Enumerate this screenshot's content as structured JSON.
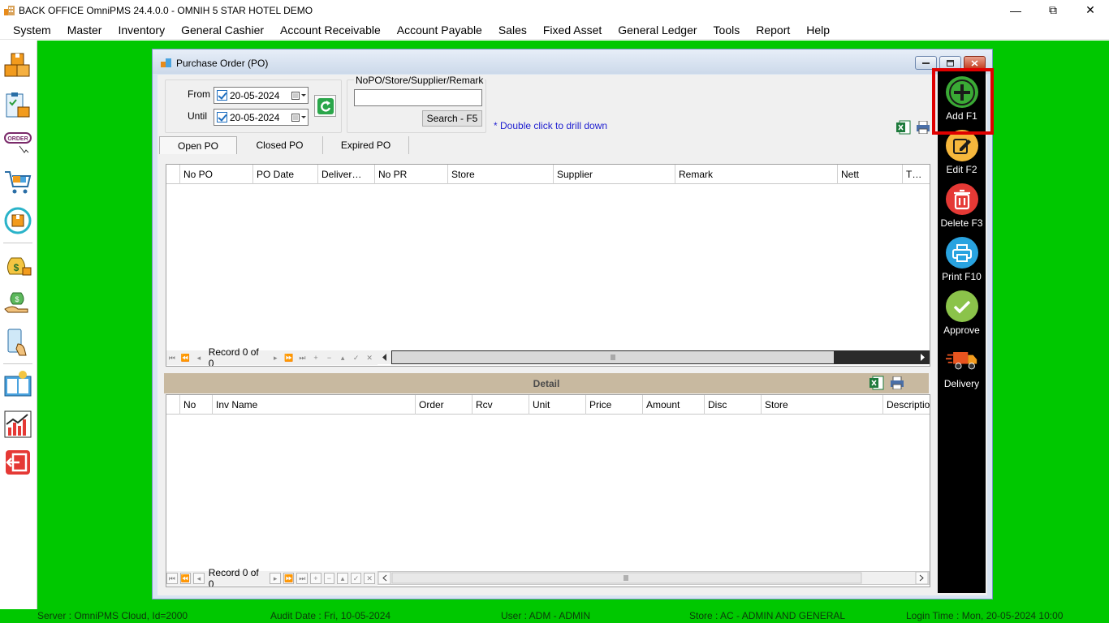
{
  "window": {
    "title": "BACK OFFICE OmniPMS 24.4.0.0 - OMNIH 5 STAR HOTEL DEMO",
    "minimize": "—",
    "maximize": "⧉",
    "close": "✕"
  },
  "menu": [
    "System",
    "Master",
    "Inventory",
    "General Cashier",
    "Account Receivable",
    "Account Payable",
    "Sales",
    "Fixed Asset",
    "General Ledger",
    "Tools",
    "Report",
    "Help"
  ],
  "child_window": {
    "title": "Purchase Order (PO)"
  },
  "filter": {
    "from_label": "From",
    "from_value": "20-05-2024",
    "until_label": "Until",
    "until_value": "20-05-2024",
    "search_group_label": "NoPO/Store/Supplier/Remark",
    "search_value": "",
    "search_button": "Search - F5",
    "hint": "* Double click to drill down"
  },
  "tabs": [
    "Open PO",
    "Closed PO",
    "Expired PO"
  ],
  "po_grid": {
    "columns": [
      "No PO",
      "PO Date",
      "Deliver…",
      "No PR",
      "Store",
      "Supplier",
      "Remark",
      "Nett",
      "T…"
    ],
    "navigator_text": "Record 0 of 0"
  },
  "detail": {
    "title": "Detail",
    "columns": [
      "No",
      "Inv Name",
      "Order",
      "Rcv",
      "Unit",
      "Price",
      "Amount",
      "Disc",
      "Store",
      "Description"
    ],
    "navigator_text": "Record 0 of 0"
  },
  "actions": [
    {
      "label": "Add F1",
      "icon": "add-icon",
      "color": "#3aaa35"
    },
    {
      "label": "Edit F2",
      "icon": "edit-icon",
      "color": "#f6b73c"
    },
    {
      "label": "Delete F3",
      "icon": "delete-icon",
      "color": "#e53935"
    },
    {
      "label": "Print F10",
      "icon": "print-icon",
      "color": "#29a3e0"
    },
    {
      "label": "Approve",
      "icon": "approve-icon",
      "color": "#8bc34a"
    },
    {
      "label": "Delivery",
      "icon": "delivery-truck-icon",
      "color": "#e8541f"
    }
  ],
  "statusbar": {
    "server": "Server : OmniPMS Cloud, Id=2000",
    "audit": "Audit Date : Fri, 10-05-2024",
    "user": "User : ADM - ADMIN",
    "store": "Store : AC - ADMIN AND GENERAL",
    "login": "Login Time : Mon, 20-05-2024 10:00"
  },
  "colors": {
    "desktop": "#00c800",
    "highlight": "#e00000"
  }
}
